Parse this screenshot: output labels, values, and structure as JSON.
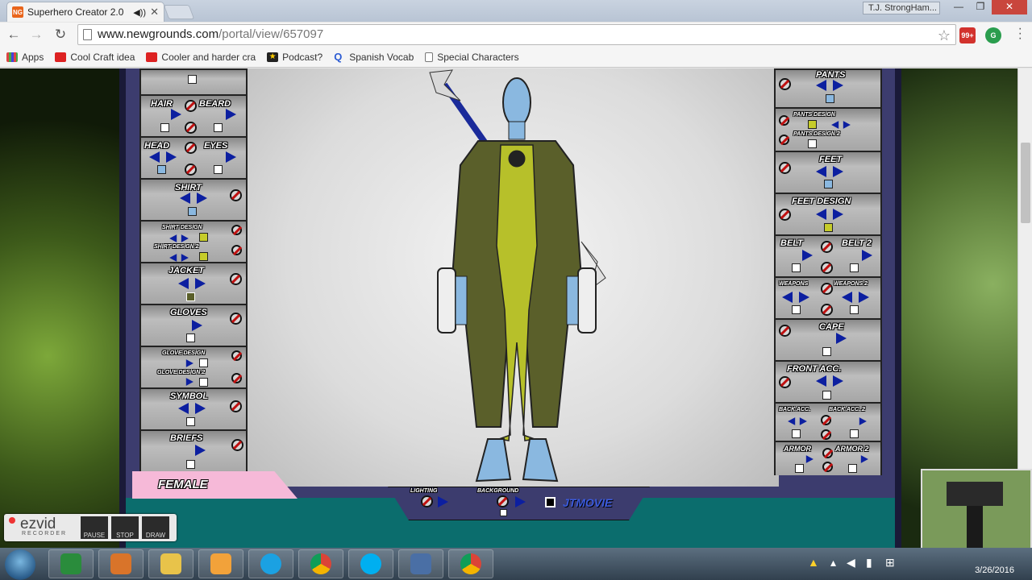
{
  "browser": {
    "tab_title": "Superhero Creator 2.0",
    "tab_icon_text": "NG",
    "user": "T.J. StrongHam...",
    "url_host": "www.newgrounds.com",
    "url_path": "/portal/view/657097",
    "ext_badge": "99+",
    "bookmarks": [
      "Apps",
      "Cool Craft idea",
      "Cooler and harder cra",
      "Podcast?",
      "Spanish Vocab",
      "Special Characters"
    ]
  },
  "left_panel": [
    {
      "label": "HAIR",
      "label2": "BEARD"
    },
    {
      "label": "HEAD",
      "label2": "EYES"
    },
    {
      "label": "SHIRT"
    },
    {
      "label": "SHIRT DESIGN",
      "label2": "SHIRT DESIGN 2"
    },
    {
      "label": "JACKET"
    },
    {
      "label": "GLOVES"
    },
    {
      "label": "GLOVE DESIGN",
      "label2": "GLOVE DESIGN 2"
    },
    {
      "label": "SYMBOL"
    },
    {
      "label": "BRIEFS"
    }
  ],
  "right_panel": [
    {
      "label": "PANTS"
    },
    {
      "label": "PANTS DESIGN",
      "label2": "PANTS DESIGN 2"
    },
    {
      "label": "FEET"
    },
    {
      "label": "FEET DESIGN"
    },
    {
      "label": "BELT",
      "label2": "BELT 2"
    },
    {
      "label": "WEAPONS",
      "label2": "WEAPONS 2"
    },
    {
      "label": "CAPE"
    },
    {
      "label": "FRONT ACC."
    },
    {
      "label": "BACK ACC.",
      "label2": "BACK ACC. 2"
    },
    {
      "label": "ARMOR",
      "label2": "ARMOR 2"
    }
  ],
  "bottom": {
    "gender": "FEMALE",
    "lighting": "LIGHTING",
    "background": "BACKGROUND",
    "credit": "JTMOVIE"
  },
  "ezvid": {
    "logo": "ezvid",
    "sub": "RECORDER",
    "pause": "PAUSE",
    "stop": "STOP",
    "draw": "DRAW"
  },
  "taskbar": {
    "date": "3/26/2016"
  },
  "colors": {
    "arrow_blue": "#0c1fa0",
    "skin_blue": "#8ab8e0",
    "coat_olive": "#5a5f2a",
    "suit_yellow": "#b7c02a",
    "credit_blue": "#3a5adc"
  }
}
